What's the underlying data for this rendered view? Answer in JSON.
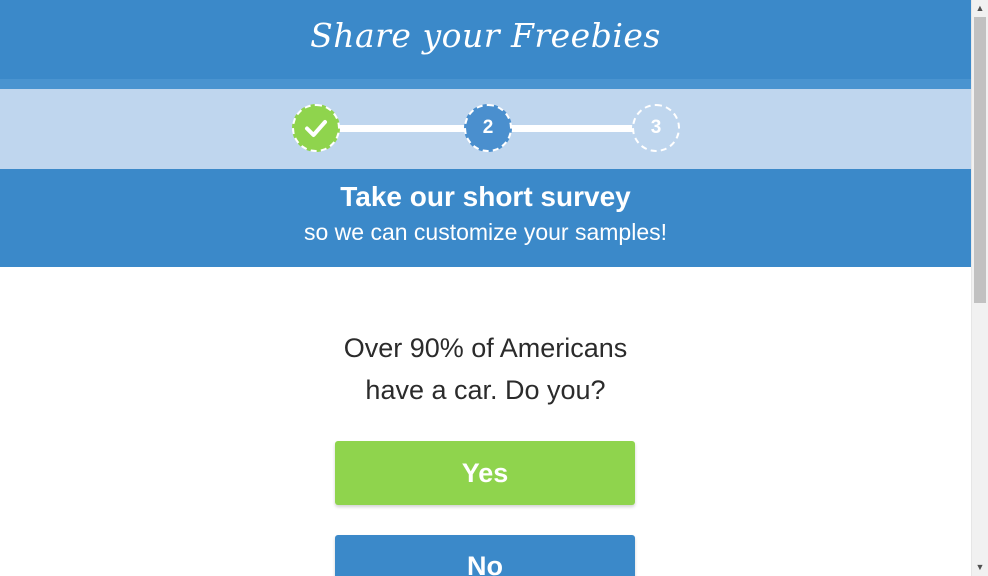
{
  "header": {
    "logo_text": "Share your Freebies"
  },
  "progress": {
    "steps": [
      {
        "label": "",
        "state": "completed",
        "icon": "check-icon"
      },
      {
        "label": "2",
        "state": "current"
      },
      {
        "label": "3",
        "state": "upcoming"
      }
    ]
  },
  "intro": {
    "title": "Take our short survey",
    "subtitle": "so we can customize your samples!"
  },
  "survey": {
    "question_line1": "Over 90% of Americans",
    "question_line2": "have a car. Do you?",
    "yes_label": "Yes",
    "no_label": "No"
  },
  "colors": {
    "header_blue": "#3b89c9",
    "progress_band": "#bfd6ee",
    "accent_green": "#8fd44d",
    "current_step_blue": "#4a8fce"
  }
}
